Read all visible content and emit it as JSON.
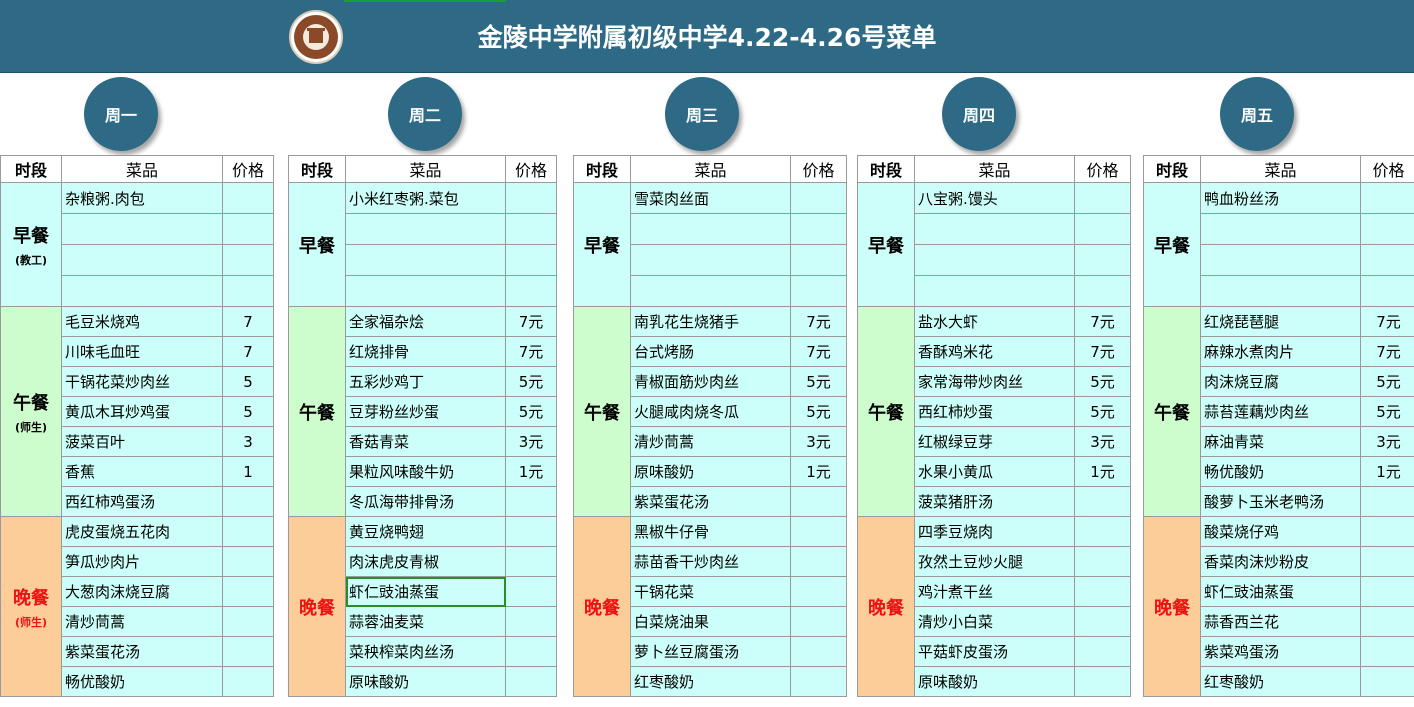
{
  "header": {
    "title": "金陵中学附属初级中学4.22-4.26号菜单",
    "bg_color": "#2e6a86"
  },
  "columns": {
    "slot": "时段",
    "dish": "菜品",
    "price": "价格"
  },
  "meal_labels": {
    "breakfast": "早餐",
    "lunch": "午餐",
    "dinner": "晚餐"
  },
  "days": [
    {
      "name": "周一",
      "breakfast_note": "(教工)",
      "lunch_note": "(师生)",
      "dinner_note": "(师生)",
      "breakfast": [
        {
          "dish": "杂粮粥.肉包",
          "price": ""
        },
        {
          "dish": "",
          "price": ""
        },
        {
          "dish": "",
          "price": ""
        },
        {
          "dish": "",
          "price": ""
        }
      ],
      "lunch": [
        {
          "dish": "毛豆米烧鸡",
          "price": "7"
        },
        {
          "dish": "川味毛血旺",
          "price": "7"
        },
        {
          "dish": "干锅花菜炒肉丝",
          "price": "5"
        },
        {
          "dish": "黄瓜木耳炒鸡蛋",
          "price": "5"
        },
        {
          "dish": "菠菜百叶",
          "price": "3"
        },
        {
          "dish": "香蕉",
          "price": "1"
        },
        {
          "dish": "西红柿鸡蛋汤",
          "price": ""
        }
      ],
      "dinner": [
        {
          "dish": "虎皮蛋烧五花肉",
          "price": ""
        },
        {
          "dish": "笋瓜炒肉片",
          "price": ""
        },
        {
          "dish": "大葱肉沫烧豆腐",
          "price": ""
        },
        {
          "dish": "清炒茼蒿",
          "price": ""
        },
        {
          "dish": "紫菜蛋花汤",
          "price": ""
        },
        {
          "dish": "畅优酸奶",
          "price": ""
        }
      ]
    },
    {
      "name": "周二",
      "breakfast_note": "",
      "lunch_note": "",
      "dinner_note": "",
      "breakfast": [
        {
          "dish": "小米红枣粥.菜包",
          "price": ""
        },
        {
          "dish": "",
          "price": ""
        },
        {
          "dish": "",
          "price": ""
        },
        {
          "dish": "",
          "price": ""
        }
      ],
      "lunch": [
        {
          "dish": "全家福杂烩",
          "price": "7元"
        },
        {
          "dish": "红烧排骨",
          "price": "7元"
        },
        {
          "dish": "五彩炒鸡丁",
          "price": "5元"
        },
        {
          "dish": "豆芽粉丝炒蛋",
          "price": "5元"
        },
        {
          "dish": "香菇青菜",
          "price": "3元"
        },
        {
          "dish": "果粒风味酸牛奶",
          "price": "1元"
        },
        {
          "dish": "冬瓜海带排骨汤",
          "price": ""
        }
      ],
      "dinner": [
        {
          "dish": "黄豆烧鸭翅",
          "price": ""
        },
        {
          "dish": "肉沫虎皮青椒",
          "price": ""
        },
        {
          "dish": "虾仁豉油蒸蛋",
          "price": ""
        },
        {
          "dish": "蒜蓉油麦菜",
          "price": ""
        },
        {
          "dish": "菜秧榨菜肉丝汤",
          "price": ""
        },
        {
          "dish": "原味酸奶",
          "price": ""
        }
      ]
    },
    {
      "name": "周三",
      "breakfast_note": "",
      "lunch_note": "",
      "dinner_note": "",
      "breakfast": [
        {
          "dish": "雪菜肉丝面",
          "price": ""
        },
        {
          "dish": "",
          "price": ""
        },
        {
          "dish": "",
          "price": ""
        },
        {
          "dish": "",
          "price": ""
        }
      ],
      "lunch": [
        {
          "dish": "南乳花生烧猪手",
          "price": "7元"
        },
        {
          "dish": "台式烤肠",
          "price": "7元"
        },
        {
          "dish": "青椒面筋炒肉丝",
          "price": "5元"
        },
        {
          "dish": "火腿咸肉烧冬瓜",
          "price": "5元"
        },
        {
          "dish": "清炒茼蒿",
          "price": "3元"
        },
        {
          "dish": "原味酸奶",
          "price": "1元"
        },
        {
          "dish": "紫菜蛋花汤",
          "price": ""
        }
      ],
      "dinner": [
        {
          "dish": "黑椒牛仔骨",
          "price": ""
        },
        {
          "dish": "蒜苗香干炒肉丝",
          "price": ""
        },
        {
          "dish": "干锅花菜",
          "price": ""
        },
        {
          "dish": "白菜烧油果",
          "price": ""
        },
        {
          "dish": "萝卜丝豆腐蛋汤",
          "price": ""
        },
        {
          "dish": "红枣酸奶",
          "price": ""
        }
      ]
    },
    {
      "name": "周四",
      "breakfast_note": "",
      "lunch_note": "",
      "dinner_note": "",
      "breakfast": [
        {
          "dish": "八宝粥.馒头",
          "price": ""
        },
        {
          "dish": "",
          "price": ""
        },
        {
          "dish": "",
          "price": ""
        },
        {
          "dish": "",
          "price": ""
        }
      ],
      "lunch": [
        {
          "dish": "盐水大虾",
          "price": "7元"
        },
        {
          "dish": "香酥鸡米花",
          "price": "7元"
        },
        {
          "dish": "家常海带炒肉丝",
          "price": "5元"
        },
        {
          "dish": "西红柿炒蛋",
          "price": "5元"
        },
        {
          "dish": "红椒绿豆芽",
          "price": "3元"
        },
        {
          "dish": "水果小黄瓜",
          "price": "1元"
        },
        {
          "dish": "菠菜猪肝汤",
          "price": ""
        }
      ],
      "dinner": [
        {
          "dish": "四季豆烧肉",
          "price": ""
        },
        {
          "dish": "孜然土豆炒火腿",
          "price": ""
        },
        {
          "dish": "鸡汁煮干丝",
          "price": ""
        },
        {
          "dish": "清炒小白菜",
          "price": ""
        },
        {
          "dish": "平菇虾皮蛋汤",
          "price": ""
        },
        {
          "dish": "原味酸奶",
          "price": ""
        }
      ]
    },
    {
      "name": "周五",
      "breakfast_note": "",
      "lunch_note": "",
      "dinner_note": "",
      "breakfast": [
        {
          "dish": "鸭血粉丝汤",
          "price": ""
        },
        {
          "dish": "",
          "price": ""
        },
        {
          "dish": "",
          "price": ""
        },
        {
          "dish": "",
          "price": ""
        }
      ],
      "lunch": [
        {
          "dish": "红烧琵琶腿",
          "price": "7元"
        },
        {
          "dish": "麻辣水煮肉片",
          "price": "7元"
        },
        {
          "dish": "肉沫烧豆腐",
          "price": "5元"
        },
        {
          "dish": "蒜苔莲藕炒肉丝",
          "price": "5元"
        },
        {
          "dish": "麻油青菜",
          "price": "3元"
        },
        {
          "dish": "畅优酸奶",
          "price": "1元"
        },
        {
          "dish": "酸萝卜玉米老鸭汤",
          "price": ""
        }
      ],
      "dinner": [
        {
          "dish": "酸菜烧仔鸡",
          "price": ""
        },
        {
          "dish": "香菜肉沫炒粉皮",
          "price": ""
        },
        {
          "dish": "虾仁豉油蒸蛋",
          "price": ""
        },
        {
          "dish": "蒜香西兰花",
          "price": ""
        },
        {
          "dish": "紫菜鸡蛋汤",
          "price": ""
        },
        {
          "dish": "红枣酸奶",
          "price": ""
        }
      ]
    }
  ],
  "colors": {
    "breakfast": "#ccfff9",
    "lunch": "#cdfccd",
    "dinner": "#fccc99",
    "dinner_text": "#ee1111"
  }
}
